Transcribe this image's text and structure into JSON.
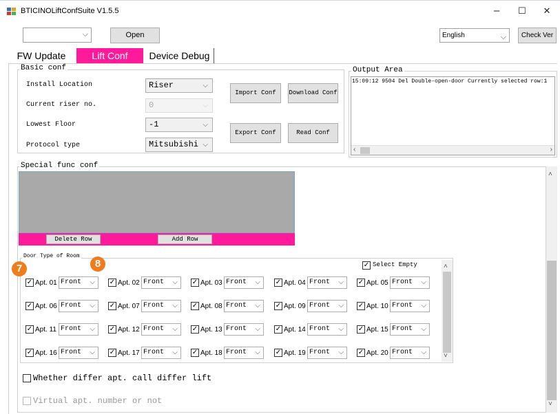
{
  "window": {
    "title": "BTICINOLiftConfSuite V1.5.5",
    "minimize": "–",
    "maximize": "☐",
    "close": "✕"
  },
  "toolbar": {
    "port_value": "",
    "open_label": "Open",
    "language": "English",
    "check_ver_label": "Check Ver"
  },
  "tabs": [
    {
      "label": "FW Update"
    },
    {
      "label": "Lift Conf"
    },
    {
      "label": "Device Debug"
    }
  ],
  "basic_conf": {
    "title": "Basic conf",
    "install_location_label": "Install Location",
    "install_location_value": "Riser",
    "riser_label": "Current riser no.",
    "riser_value": "0",
    "lowest_floor_label": "Lowest Floor",
    "lowest_floor_value": "-1",
    "protocol_label": "Protocol type",
    "protocol_value": "Mitsubishi",
    "import_label": "Import Conf",
    "download_label": "Download Conf",
    "export_label": "Export Conf",
    "read_label": "Read Conf"
  },
  "output": {
    "title": "Output Area",
    "log": "15:09:12 9504  Del Double-open-door Currently selected row:1"
  },
  "special": {
    "title": "Special func conf",
    "delete_row": "Delete Row",
    "add_row": "Add Row"
  },
  "door_type": {
    "title": "Door Type of Room",
    "select_empty": "Select Empty",
    "apts": [
      {
        "label": "Apt. 01",
        "value": "Front"
      },
      {
        "label": "Apt. 02",
        "value": "Front"
      },
      {
        "label": "Apt. 03",
        "value": "Front"
      },
      {
        "label": "Apt. 04",
        "value": "Front"
      },
      {
        "label": "Apt. 05",
        "value": "Front"
      },
      {
        "label": "Apt. 06",
        "value": "Front"
      },
      {
        "label": "Apt. 07",
        "value": "Front"
      },
      {
        "label": "Apt. 08",
        "value": "Front"
      },
      {
        "label": "Apt. 09",
        "value": "Front"
      },
      {
        "label": "Apt. 10",
        "value": "Front"
      },
      {
        "label": "Apt. 11",
        "value": "Front"
      },
      {
        "label": "Apt. 12",
        "value": "Front"
      },
      {
        "label": "Apt. 13",
        "value": "Front"
      },
      {
        "label": "Apt. 14",
        "value": "Front"
      },
      {
        "label": "Apt. 15",
        "value": "Front"
      },
      {
        "label": "Apt. 16",
        "value": "Front"
      },
      {
        "label": "Apt. 17",
        "value": "Front"
      },
      {
        "label": "Apt. 18",
        "value": "Front"
      },
      {
        "label": "Apt. 19",
        "value": "Front"
      },
      {
        "label": "Apt. 20",
        "value": "Front"
      }
    ]
  },
  "options": {
    "differ_lift": "Whether differ apt. call differ lift",
    "virtual_apt": "Virtual apt. number or not"
  },
  "annotations": {
    "badge_a": "7",
    "badge_b": "8"
  },
  "colors": {
    "accent_pink": "#ff1a9c",
    "badge_orange": "#f07c1b",
    "grid_gray": "#a9a9a9"
  }
}
